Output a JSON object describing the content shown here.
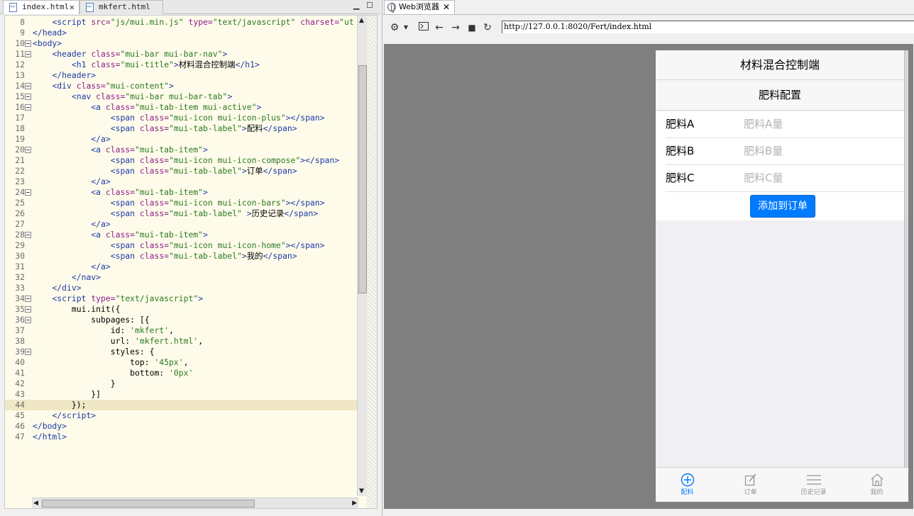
{
  "editor": {
    "tabs": [
      {
        "label": "index.html"
      },
      {
        "label": "mkfert.html"
      }
    ],
    "lines": [
      {
        "n": "8",
        "fold": false,
        "cur": false,
        "html": "    <span class='tg'>&lt;script</span> <span class='at'>src=</span><span class='st'>\"js/mui.min.js\"</span> <span class='at'>type=</span><span class='st'>\"text/javascript\"</span> <span class='at'>charset=</span><span class='st'>\"ut</span>"
      },
      {
        "n": "9",
        "fold": false,
        "cur": false,
        "html": "<span class='tg'>&lt;/head&gt;</span>"
      },
      {
        "n": "10",
        "fold": true,
        "cur": false,
        "html": "<span class='tg'>&lt;body&gt;</span>"
      },
      {
        "n": "11",
        "fold": true,
        "cur": false,
        "html": "    <span class='tg'>&lt;header</span> <span class='at'>class=</span><span class='st'>\"mui-bar mui-bar-nav\"</span><span class='tg'>&gt;</span>"
      },
      {
        "n": "12",
        "fold": false,
        "cur": false,
        "html": "        <span class='tg'>&lt;h1</span> <span class='at'>class=</span><span class='st'>\"mui-title\"</span><span class='tg'>&gt;</span><span class='tx'>材料混合控制端</span><span class='tg'>&lt;/h1&gt;</span>"
      },
      {
        "n": "13",
        "fold": false,
        "cur": false,
        "html": "    <span class='tg'>&lt;/header&gt;</span>"
      },
      {
        "n": "14",
        "fold": true,
        "cur": false,
        "html": "    <span class='tg'>&lt;div</span> <span class='at'>class=</span><span class='st'>\"mui-content\"</span><span class='tg'>&gt;</span>"
      },
      {
        "n": "15",
        "fold": true,
        "cur": false,
        "html": "        <span class='tg'>&lt;nav</span> <span class='at'>class=</span><span class='st'>\"mui-bar mui-bar-tab\"</span><span class='tg'>&gt;</span>"
      },
      {
        "n": "16",
        "fold": true,
        "cur": false,
        "html": "            <span class='tg'>&lt;a</span> <span class='at'>class=</span><span class='st'>\"mui-tab-item mui-active\"</span><span class='tg'>&gt;</span>"
      },
      {
        "n": "17",
        "fold": false,
        "cur": false,
        "html": "                <span class='tg'>&lt;span</span> <span class='at'>class=</span><span class='st'>\"mui-icon mui-icon-plus\"</span><span class='tg'>&gt;&lt;/span&gt;</span>"
      },
      {
        "n": "18",
        "fold": false,
        "cur": false,
        "html": "                <span class='tg'>&lt;span</span> <span class='at'>class=</span><span class='st'>\"mui-tab-label\"</span><span class='tg'>&gt;</span><span class='tx'>配料</span><span class='tg'>&lt;/span&gt;</span>"
      },
      {
        "n": "19",
        "fold": false,
        "cur": false,
        "html": "            <span class='tg'>&lt;/a&gt;</span>"
      },
      {
        "n": "20",
        "fold": true,
        "cur": false,
        "html": "            <span class='tg'>&lt;a</span> <span class='at'>class=</span><span class='st'>\"mui-tab-item\"</span><span class='tg'>&gt;</span>"
      },
      {
        "n": "21",
        "fold": false,
        "cur": false,
        "html": "                <span class='tg'>&lt;span</span> <span class='at'>class=</span><span class='st'>\"mui-icon mui-icon-compose\"</span><span class='tg'>&gt;&lt;/span&gt;</span>"
      },
      {
        "n": "22",
        "fold": false,
        "cur": false,
        "html": "                <span class='tg'>&lt;span</span> <span class='at'>class=</span><span class='st'>\"mui-tab-label\"</span><span class='tg'>&gt;</span><span class='tx'>订单</span><span class='tg'>&lt;/span&gt;</span>"
      },
      {
        "n": "23",
        "fold": false,
        "cur": false,
        "html": "            <span class='tg'>&lt;/a&gt;</span>"
      },
      {
        "n": "24",
        "fold": true,
        "cur": false,
        "html": "            <span class='tg'>&lt;a</span> <span class='at'>class=</span><span class='st'>\"mui-tab-item\"</span><span class='tg'>&gt;</span>"
      },
      {
        "n": "25",
        "fold": false,
        "cur": false,
        "html": "                <span class='tg'>&lt;span</span> <span class='at'>class=</span><span class='st'>\"mui-icon mui-icon-bars\"</span><span class='tg'>&gt;&lt;/span&gt;</span>"
      },
      {
        "n": "26",
        "fold": false,
        "cur": false,
        "html": "                <span class='tg'>&lt;span</span> <span class='at'>class=</span><span class='st'>\"mui-tab-label\"</span> <span class='tg'>&gt;</span><span class='tx'>历史记录</span><span class='tg'>&lt;/span&gt;</span>"
      },
      {
        "n": "27",
        "fold": false,
        "cur": false,
        "html": "            <span class='tg'>&lt;/a&gt;</span>"
      },
      {
        "n": "28",
        "fold": true,
        "cur": false,
        "html": "            <span class='tg'>&lt;a</span> <span class='at'>class=</span><span class='st'>\"mui-tab-item\"</span><span class='tg'>&gt;</span>"
      },
      {
        "n": "29",
        "fold": false,
        "cur": false,
        "html": "                <span class='tg'>&lt;span</span> <span class='at'>class=</span><span class='st'>\"mui-icon mui-icon-home\"</span><span class='tg'>&gt;&lt;/span&gt;</span>"
      },
      {
        "n": "30",
        "fold": false,
        "cur": false,
        "html": "                <span class='tg'>&lt;span</span> <span class='at'>class=</span><span class='st'>\"mui-tab-label\"</span><span class='tg'>&gt;</span><span class='tx'>我的</span><span class='tg'>&lt;/span&gt;</span>"
      },
      {
        "n": "31",
        "fold": false,
        "cur": false,
        "html": "            <span class='tg'>&lt;/a&gt;</span>"
      },
      {
        "n": "32",
        "fold": false,
        "cur": false,
        "html": "        <span class='tg'>&lt;/nav&gt;</span>"
      },
      {
        "n": "33",
        "fold": false,
        "cur": false,
        "html": "    <span class='tg'>&lt;/div&gt;</span>"
      },
      {
        "n": "34",
        "fold": true,
        "cur": false,
        "html": "    <span class='tg'>&lt;script</span> <span class='at'>type=</span><span class='st'>\"text/javascript\"</span><span class='tg'>&gt;</span>"
      },
      {
        "n": "35",
        "fold": true,
        "cur": false,
        "html": "        <span class='tx'>mui.init({</span>"
      },
      {
        "n": "36",
        "fold": true,
        "cur": false,
        "html": "            <span class='tx'>subpages: [{</span>"
      },
      {
        "n": "37",
        "fold": false,
        "cur": false,
        "html": "                <span class='tx'>id: </span><span class='st'>'mkfert'</span><span class='tx'>,</span>"
      },
      {
        "n": "38",
        "fold": false,
        "cur": false,
        "html": "                <span class='tx'>url: </span><span class='st'>'mkfert.html'</span><span class='tx'>,</span>"
      },
      {
        "n": "39",
        "fold": true,
        "cur": false,
        "html": "                <span class='tx'>styles: {</span>"
      },
      {
        "n": "40",
        "fold": false,
        "cur": false,
        "html": "                    <span class='tx'>top: </span><span class='st'>'45px'</span><span class='tx'>,</span>"
      },
      {
        "n": "41",
        "fold": false,
        "cur": false,
        "html": "                    <span class='tx'>bottom: </span><span class='st'>'0px'</span>"
      },
      {
        "n": "42",
        "fold": false,
        "cur": false,
        "html": "                <span class='tx'>}</span>"
      },
      {
        "n": "43",
        "fold": false,
        "cur": false,
        "html": "            <span class='tx'>}]</span>"
      },
      {
        "n": "44",
        "fold": false,
        "cur": true,
        "html": "        <span class='tx'>});</span>"
      },
      {
        "n": "45",
        "fold": false,
        "cur": false,
        "html": "    <span class='tg'>&lt;/script&gt;</span>"
      },
      {
        "n": "46",
        "fold": false,
        "cur": false,
        "html": "<span class='tg'>&lt;/body&gt;</span>"
      },
      {
        "n": "47",
        "fold": false,
        "cur": false,
        "html": "<span class='tg'>&lt;/html&gt;</span>"
      }
    ]
  },
  "browser": {
    "tab_label": "Web浏览器",
    "url": "http://127.0.0.1:8020/Fert/index.html"
  },
  "app": {
    "title": "材料混合控制端",
    "section_title": "肥料配置",
    "fields": [
      {
        "label": "肥料A",
        "placeholder": "肥料A量"
      },
      {
        "label": "肥料B",
        "placeholder": "肥料B量"
      },
      {
        "label": "肥料C",
        "placeholder": "肥料C量"
      }
    ],
    "add_button": "添加到订单",
    "tabs": [
      {
        "label": "配料",
        "icon": "plus-circle-icon",
        "active": true
      },
      {
        "label": "订单",
        "icon": "compose-icon",
        "active": false
      },
      {
        "label": "历史记录",
        "icon": "bars-icon",
        "active": false
      },
      {
        "label": "我的",
        "icon": "home-icon",
        "active": false
      }
    ],
    "accent_color": "#007aff"
  }
}
